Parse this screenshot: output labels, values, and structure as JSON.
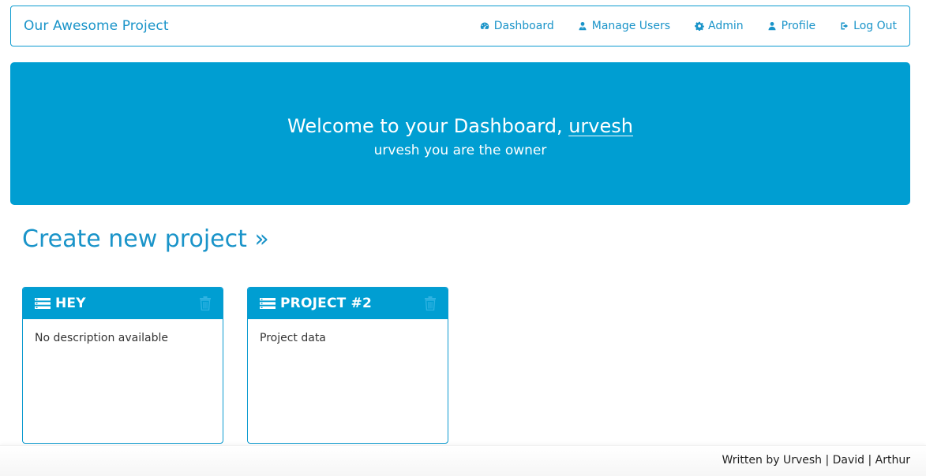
{
  "navbar": {
    "brand": "Our Awesome Project",
    "links": [
      {
        "label": "Dashboard",
        "icon": "dashboard-icon"
      },
      {
        "label": "Manage Users",
        "icon": "users-icon"
      },
      {
        "label": "Admin",
        "icon": "gear-icon"
      },
      {
        "label": "Profile",
        "icon": "user-icon"
      },
      {
        "label": "Log Out",
        "icon": "logout-icon"
      }
    ]
  },
  "jumbotron": {
    "welcome_prefix": "Welcome to your Dashboard, ",
    "username": "urvesh",
    "owner_line": "urvesh you are the owner"
  },
  "create_project": {
    "label": "Create new project »"
  },
  "projects": [
    {
      "title": "HEY",
      "description": "No description available"
    },
    {
      "title": "PROJECT #2",
      "description": "Project data"
    }
  ],
  "footer": {
    "text": "Written by Urvesh | David | Arthur"
  },
  "colors": {
    "primary": "#009ed2",
    "link": "#1a94c9",
    "trash_icon": "#2fb3e2"
  }
}
